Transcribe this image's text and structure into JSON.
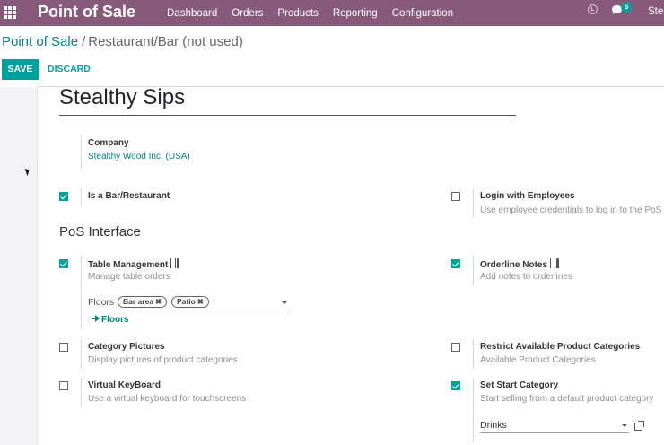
{
  "navbar": {
    "app_name": "Point of Sale",
    "menu": [
      "Dashboard",
      "Orders",
      "Products",
      "Reporting",
      "Configuration"
    ],
    "chat_count": "6",
    "user": "Stea",
    "background_color": "#875a7b",
    "icons": [
      "apps-grid-icon",
      "clock-icon",
      "chat-icon"
    ]
  },
  "breadcrumb": {
    "parent": "Point of Sale",
    "separator": "/",
    "current": "Restaurant/Bar (not used)"
  },
  "buttons": {
    "save": "SAVE",
    "discard": "DISCARD"
  },
  "form": {
    "name": "Stealthy Sips",
    "company_label": "Company",
    "company_value": "Stealthy Wood Inc. (USA)",
    "is_bar": {
      "label": "Is a Bar/Restaurant",
      "checked": true
    },
    "login_employees": {
      "label": "Login with Employees",
      "desc": "Use employee credentials to log in to the PoS",
      "checked": false
    },
    "section_title": "PoS Interface",
    "table_management": {
      "label": "Table Management",
      "desc": "Manage table orders",
      "checked": true
    },
    "orderline_notes": {
      "label": "Orderline Notes",
      "desc": "Add notes to orderlines",
      "checked": true
    },
    "floors": {
      "label": "Floors",
      "tags": [
        "Bar area",
        "Patio"
      ],
      "tag_remove": "✖",
      "button": "Floors"
    },
    "category_pictures": {
      "label": "Category Pictures",
      "desc": "Display pictures of product categories",
      "checked": false
    },
    "restrict_categories": {
      "label": "Restrict Available Product Categories",
      "desc": "Available Product Categories",
      "checked": false
    },
    "virtual_keyboard": {
      "label": "Virtual KeyBoard",
      "desc": "Use a virtual keyboard for touchscreens",
      "checked": false
    },
    "start_category": {
      "label": "Set Start Category",
      "desc": "Start selling from a default product category",
      "checked": true,
      "value": "Drinks"
    }
  },
  "accent_color": "#00a09d"
}
